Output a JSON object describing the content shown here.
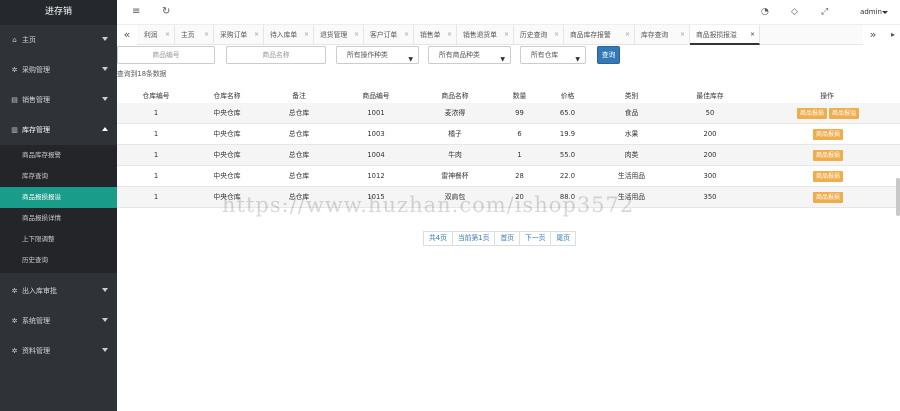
{
  "app": {
    "brand": "进存销"
  },
  "colors": {
    "sidebar_bg": "#2f3237",
    "active_sub": "#1a9c8a",
    "primary": "#3379b7",
    "warning": "#f0ad4e"
  },
  "sidebar": {
    "items": [
      {
        "label": "主页",
        "icon": "home-icon",
        "glyph": "⌂"
      },
      {
        "label": "采购管理",
        "icon": "gear-icon",
        "glyph": "✲"
      },
      {
        "label": "销售管理",
        "icon": "chart-icon",
        "glyph": "▤"
      },
      {
        "label": "库存管理",
        "icon": "chart-icon",
        "glyph": "▥"
      },
      {
        "label": "出入库审批",
        "icon": "gear-icon",
        "glyph": "✲"
      },
      {
        "label": "系统管理",
        "icon": "gear-icon",
        "glyph": "✲"
      },
      {
        "label": "资料管理",
        "icon": "gear-icon",
        "glyph": "✲"
      }
    ],
    "submenu": [
      {
        "label": "商品库存报警"
      },
      {
        "label": "库存查询"
      },
      {
        "label": "商品报损报溢"
      },
      {
        "label": "商品报损详情"
      },
      {
        "label": "上下限调整"
      },
      {
        "label": "历史查询"
      }
    ]
  },
  "topbar": {
    "menu_icon": "≡",
    "refresh_icon": "↻",
    "user": "admin",
    "right_icons": [
      "◔",
      "◇",
      "⤢"
    ]
  },
  "tabs": {
    "left_nav": "«",
    "right_nav": "»",
    "items": [
      {
        "label": "利润"
      },
      {
        "label": "主页"
      },
      {
        "label": "采购订单"
      },
      {
        "label": "待入库单"
      },
      {
        "label": "退货管理"
      },
      {
        "label": "客户订单"
      },
      {
        "label": "销售单"
      },
      {
        "label": "销售退货单"
      },
      {
        "label": "历史查询"
      },
      {
        "label": "商品库存报警"
      },
      {
        "label": "库存查询"
      },
      {
        "label": "商品报损报溢"
      }
    ],
    "close_glyph": "×"
  },
  "filters": {
    "code_placeholder": "商品编号",
    "name_placeholder": "商品名称",
    "op_type": "所有操作种类",
    "goods_type": "所有商品种类",
    "warehouse": "所有仓库",
    "query": "查询"
  },
  "result_text": "查询到18条数据",
  "table": {
    "headers": [
      "仓库编号",
      "仓库名称",
      "备注",
      "商品编号",
      "商品名称",
      "数量",
      "价格",
      "类别",
      "最佳库存",
      "操作"
    ],
    "rows": [
      {
        "c": [
          "1",
          "中央仓库",
          "总仓库",
          "1001",
          "麦浓得",
          "99",
          "65.0",
          "食品",
          "50"
        ],
        "ops": [
          "商品报损",
          "商品报溢"
        ]
      },
      {
        "c": [
          "1",
          "中央仓库",
          "总仓库",
          "1003",
          "橘子",
          "6",
          "19.9",
          "水果",
          "200"
        ],
        "ops": [
          "商品报损"
        ]
      },
      {
        "c": [
          "1",
          "中央仓库",
          "总仓库",
          "1004",
          "牛肉",
          "1",
          "55.0",
          "肉类",
          "200"
        ],
        "ops": [
          "商品报损"
        ]
      },
      {
        "c": [
          "1",
          "中央仓库",
          "总仓库",
          "1012",
          "雷神餐杯",
          "28",
          "22.0",
          "生活用品",
          "300"
        ],
        "ops": [
          "商品报损"
        ]
      },
      {
        "c": [
          "1",
          "中央仓库",
          "总仓库",
          "1015",
          "双肩包",
          "20",
          "88.0",
          "生活用品",
          "350"
        ],
        "ops": [
          "商品报损"
        ]
      }
    ]
  },
  "pager": {
    "total": "共4页",
    "current": "当前第1页",
    "first": "首页",
    "next": "下一页",
    "last": "尾页"
  },
  "watermark": "https://www.huzhan.com/ishop3572"
}
